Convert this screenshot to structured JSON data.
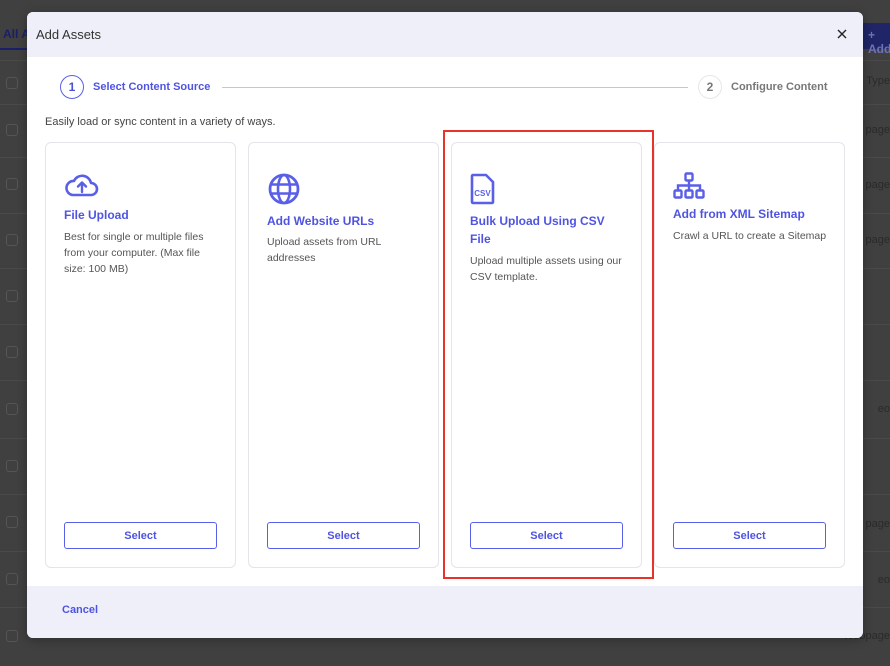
{
  "background": {
    "tab_label": "All A",
    "add_button_label": "+ Add",
    "column_header_right": "ia Type",
    "row_values_right": [
      "page",
      "page",
      "page",
      "",
      "",
      "eo",
      "",
      "page",
      "eo",
      "Webpage"
    ]
  },
  "modal": {
    "title": "Add Assets",
    "close_icon": "close-icon",
    "stepper": {
      "steps": [
        {
          "number": "1",
          "label": "Select Content Source",
          "state": "active"
        },
        {
          "number": "2",
          "label": "Configure Content",
          "state": "inactive"
        }
      ]
    },
    "intro_text": "Easily load or sync content in a variety of ways.",
    "cards": [
      {
        "icon": "cloud-upload-icon",
        "title": "File Upload",
        "description": "Best for single or multiple files from your computer. (Max file size: 100 MB)",
        "button_label": "Select"
      },
      {
        "icon": "globe-icon",
        "title": "Add Website URLs",
        "description": "Upload assets from URL addresses",
        "button_label": "Select"
      },
      {
        "icon": "csv-file-icon",
        "title": "Bulk Upload Using CSV File",
        "description": "Upload multiple assets using our CSV template.",
        "button_label": "Select",
        "highlighted": true
      },
      {
        "icon": "sitemap-icon",
        "title": "Add from XML Sitemap",
        "description": "Crawl a URL to create a Sitemap",
        "button_label": "Select"
      }
    ],
    "footer": {
      "cancel_label": "Cancel"
    }
  },
  "colors": {
    "accent": "#4f54e0",
    "highlight": "#e8332a",
    "header_bg": "#eeeff8",
    "overlay": "#404040"
  }
}
